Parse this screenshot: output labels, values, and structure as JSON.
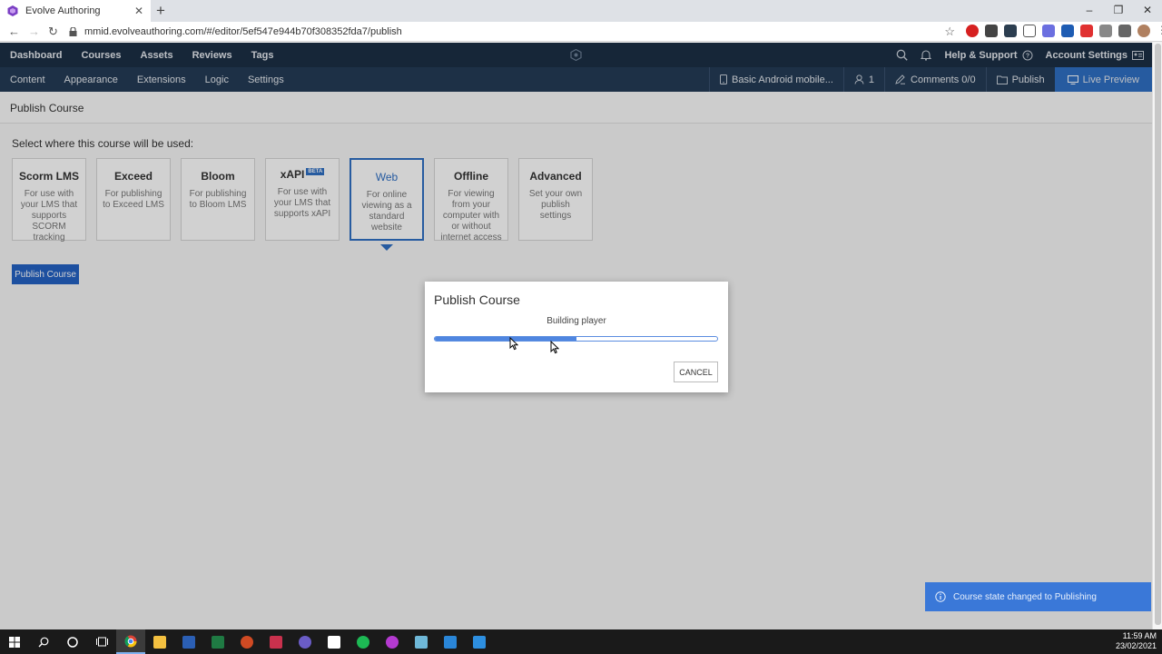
{
  "browser": {
    "tab_title": "Evolve Authoring",
    "url": "mmid.evolveauthoring.com/#/editor/5ef547e944b70f308352fda7/publish"
  },
  "nav_primary": {
    "items": [
      "Dashboard",
      "Courses",
      "Assets",
      "Reviews",
      "Tags"
    ],
    "help": "Help & Support",
    "account": "Account Settings"
  },
  "nav_secondary": {
    "items": [
      "Content",
      "Appearance",
      "Extensions",
      "Logic",
      "Settings"
    ],
    "device": "Basic Android mobile...",
    "users_count": "1",
    "comments": "Comments 0/0",
    "publish": "Publish",
    "live_preview": "Live Preview"
  },
  "page": {
    "header": "Publish Course",
    "select_label": "Select where this course will be used:",
    "options": [
      {
        "title": "Scorm LMS",
        "desc": "For use with your LMS that supports SCORM tracking"
      },
      {
        "title": "Exceed",
        "desc": "For publishing to Exceed LMS"
      },
      {
        "title": "Bloom",
        "desc": "For publishing to Bloom LMS"
      },
      {
        "title": "xAPI",
        "badge": "BETA",
        "desc": "For use with your LMS that supports xAPI"
      },
      {
        "title": "Web",
        "desc": "For online viewing as a standard website",
        "selected": true
      },
      {
        "title": "Offline",
        "desc": "For viewing from your computer with or without internet access"
      },
      {
        "title": "Advanced",
        "desc": "Set your own publish settings"
      }
    ],
    "publish_button": "Publish Course"
  },
  "modal": {
    "title": "Publish Course",
    "status": "Building player",
    "progress": 0.5,
    "cancel": "CANCEL"
  },
  "toast": {
    "message": "Course state changed to Publishing"
  },
  "clock": {
    "time": "11:59 AM",
    "date": "23/02/2021"
  },
  "colors": {
    "nav_primary_bg": "#1c2f45",
    "nav_secondary_bg": "#243b56",
    "accent": "#2f6fc4"
  }
}
